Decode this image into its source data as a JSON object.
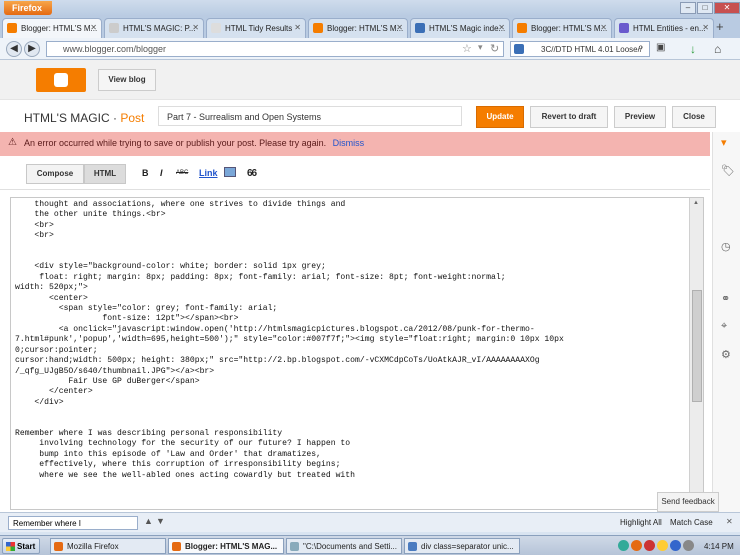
{
  "browser": {
    "menu_label": "Firefox",
    "tabs": [
      {
        "label": "Blogger: HTML'S M...",
        "icon": "blogger-favicon",
        "active": true
      },
      {
        "label": "HTML'S MAGIC: P...",
        "icon": "blank-favicon"
      },
      {
        "label": "HTML Tidy Results",
        "icon": "blank-favicon"
      },
      {
        "label": "Blogger: HTML'S M...",
        "icon": "blogger-favicon"
      },
      {
        "label": "HTML'S Magic inde...",
        "icon": "page-favicon"
      },
      {
        "label": "Blogger: HTML'S M...",
        "icon": "blogger-favicon"
      },
      {
        "label": "HTML Entities - en...",
        "icon": "entities-favicon"
      }
    ],
    "url": "www.blogger.com/blogger",
    "search_text": "3C//DTD HTML 4.01 Loose//"
  },
  "blogger": {
    "view_blog_label": "View blog",
    "blog_name": "HTML'S MAGIC ·",
    "section_label": "Post",
    "post_title": "Part 7 - Surrealism and Open Systems",
    "buttons": {
      "update": "Update",
      "revert": "Revert to draft",
      "preview": "Preview",
      "close": "Close"
    },
    "error_message": "An error occurred while trying to save or publish your post. Please try again.",
    "dismiss_label": "Dismiss",
    "modes": {
      "compose": "Compose",
      "html": "HTML"
    },
    "tools": {
      "bold": "B",
      "italic": "I",
      "strike": "ABC",
      "link": "Link",
      "quote": "66"
    },
    "send_feedback": "Send feedback",
    "code_lines": [
      "    thought and associations, where one strives to divide things and",
      "    the other unite things.<br>",
      "    <br>",
      "    <br>",
      "",
      "",
      "    <div style=\"background-color: white; border: solid 1px grey;",
      "     float: right; margin: 8px; padding: 8px; font-family: arial; font-size: 8pt; font-weight:normal;",
      "width: 520px;\">",
      "       <center>",
      "         <span style=\"color: grey; font-family: arial;",
      "                  font-size: 12pt\"></span><br>",
      "         <a onclick=\"javascript:window.open('http://htmlsmagicpictures.blogspot.ca/2012/08/punk-for-thermo-",
      "7.html#punk','popup','width=695,height=500');\" style=\"color:#007f7f;\"><img style=\"float:right; margin:0 10px 10px",
      "0;cursor:pointer;",
      "cursor:hand;width: 500px; height: 380px;\" src=\"http://2.bp.blogspot.com/-vCXMCdpCoTs/UoAtkAJR_vI/AAAAAAAAXOg",
      "/_qfg_UJgB5O/s640/thumbnail.JPG\"></a><br>",
      "           Fair Use GP duBerger</span>",
      "       </center>",
      "    </div>",
      "",
      "",
      "Remember where I was describing personal responsibility",
      "     involving technology for the security of our future? I happen to",
      "     bump into this episode of 'Law and Order' that dramatizes,",
      "     effectively, where this corruption of irresponsibility begins;",
      "     where we see the well-abled ones acting cowardly but treated with"
    ]
  },
  "findbar": {
    "value": "Remember where I",
    "highlight_all": "Highlight All",
    "match_case": "Match Case"
  },
  "taskbar": {
    "start_label": "Start",
    "tasks": [
      {
        "label": "Mozilla Firefox",
        "icon": "firefox-icon"
      },
      {
        "label": "Blogger: HTML'S MAG...",
        "icon": "firefox-icon",
        "active": true
      },
      {
        "label": "\"C:\\Documents and Setti...",
        "icon": "notepad-icon"
      },
      {
        "label": "div class=separator unic...",
        "icon": "window-icon"
      }
    ],
    "clock": "4:14 PM"
  },
  "colors": {
    "blogger_orange": "#f57d00",
    "error_bg": "#f4b4b0",
    "link_blue": "#2255cc"
  }
}
